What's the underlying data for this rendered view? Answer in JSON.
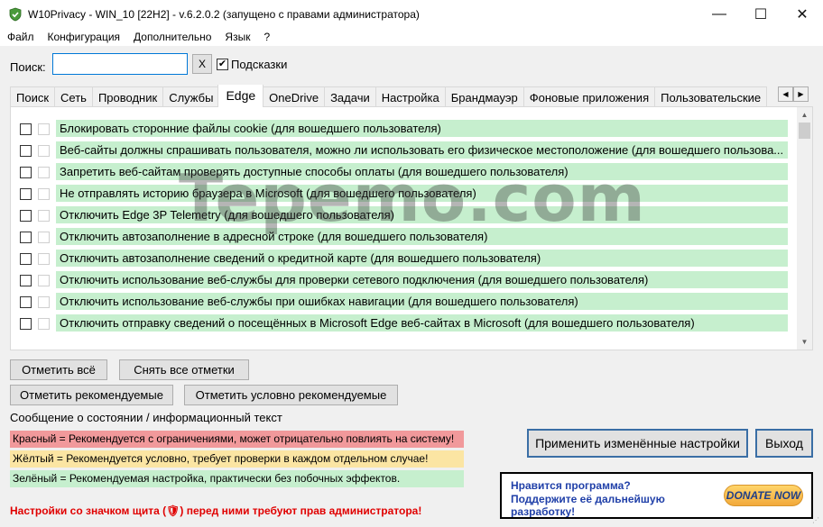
{
  "window": {
    "title": "W10Privacy - WIN_10 [22H2] - v.6.2.0.2 (запущено с правами администратора)",
    "minimize": "—",
    "maximize": "☐",
    "close": "✕",
    "icon": "shield-icon"
  },
  "menu": [
    "Файл",
    "Конфигурация",
    "Дополнительно",
    "Язык",
    "?"
  ],
  "search": {
    "label": "Поиск:",
    "value": "",
    "clear_label": "X",
    "hints_checked": true,
    "hints_label": "Подсказки"
  },
  "tabs": [
    "Поиск",
    "Сеть",
    "Проводник",
    "Службы",
    "Edge",
    "OneDrive",
    "Задачи",
    "Настройка",
    "Брандмауэр",
    "Фоновые приложения",
    "Пользовательские"
  ],
  "active_tab": "Edge",
  "settings": [
    "Блокировать сторонние файлы cookie (для вошедшего пользователя)",
    "Веб-сайты должны спрашивать пользователя, можно ли использовать его физическое местоположение (для вошедшего пользова...",
    "Запретить веб-сайтам проверять доступные способы оплаты (для вошедшего пользователя)",
    "Не отправлять историю браузера в Microsoft (для вошедшего пользователя)",
    "Отключить Edge 3P Telemetry (для вошедшего пользователя)",
    "Отключить автозаполнение в адресной строке (для вошедшего пользователя)",
    "Отключить автозаполнение сведений о кредитной карте (для вошедшего пользователя)",
    "Отключить использование веб-службы для проверки сетевого подключения (для вошедшего пользователя)",
    "Отключить использование веб-службы при ошибках навигации (для вошедшего пользователя)",
    "Отключить отправку сведений о посещённых в Microsoft Edge веб-сайтах в Microsoft (для вошедшего пользователя)"
  ],
  "watermark": "Tepemo.com",
  "buttons": {
    "check_all": "Отметить всё",
    "uncheck_all": "Снять все отметки",
    "check_recommended": "Отметить рекомендуемые",
    "check_conditional": "Отметить условно рекомендуемые",
    "apply": "Применить изменённые настройки",
    "exit": "Выход"
  },
  "status_title": "Сообщение о состоянии / информационный текст",
  "legend": {
    "red": "Красный = Рекомендуется с ограничениями, может отрицательно повлиять на систему!",
    "yellow": "Жёлтый = Рекомендуется условно, требует проверки в каждом отдельном случае!",
    "green": "Зелёный = Рекомендуемая настройка, практически без побочных эффектов."
  },
  "admin_note": "Настройки со значком щита (🛡) перед ними требуют прав администратора!",
  "donate": {
    "text_line1": "Нравится программа?",
    "text_line2": "Поддержите её дальнейшую",
    "text_line3": "разработку!",
    "button": "DONATE NOW"
  },
  "colors": {
    "green": "#c6efce",
    "yellow": "#fbe5a3",
    "red": "#f1999b",
    "accent": "#0078d7"
  }
}
